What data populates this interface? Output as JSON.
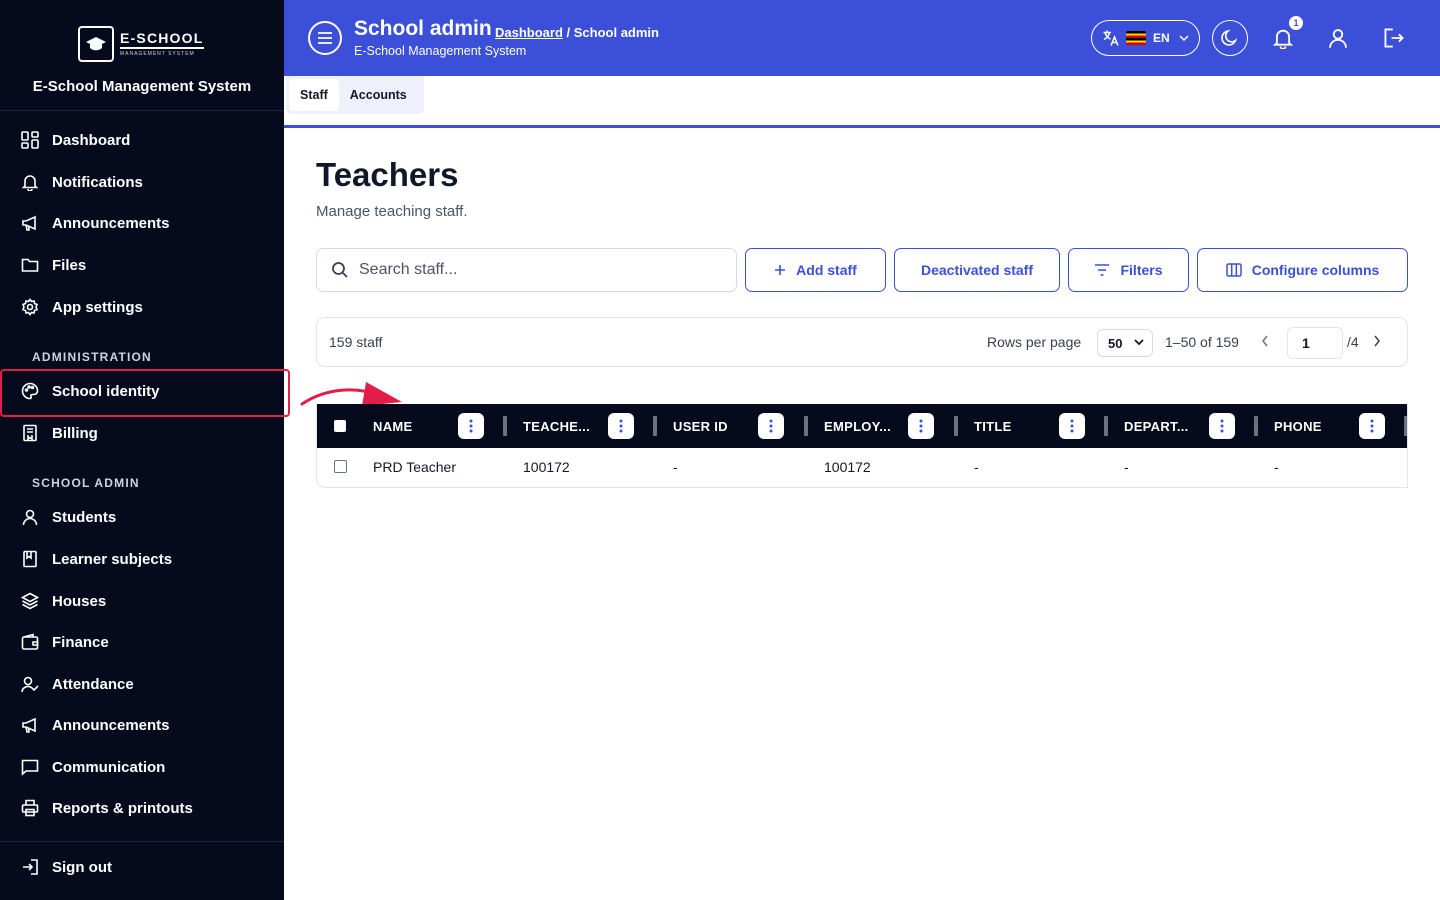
{
  "app": {
    "logo_main": "E-SCHOOL",
    "logo_sub": "MANAGEMENT SYSTEM",
    "name": "E-School Management System"
  },
  "sidebar": {
    "main_items": [
      {
        "label": "Dashboard",
        "icon": "grid-icon"
      },
      {
        "label": "Notifications",
        "icon": "bell-icon"
      },
      {
        "label": "Announcements",
        "icon": "megaphone-icon"
      },
      {
        "label": "Files",
        "icon": "folder-icon"
      },
      {
        "label": "App settings",
        "icon": "gear-icon"
      }
    ],
    "admin_label": "ADMINISTRATION",
    "admin_items": [
      {
        "label": "School identity",
        "icon": "palette-icon"
      },
      {
        "label": "Billing",
        "icon": "receipt-icon"
      }
    ],
    "school_label": "SCHOOL ADMIN",
    "school_items": [
      {
        "label": "Students",
        "icon": "user-icon"
      },
      {
        "label": "Learner subjects",
        "icon": "book-icon"
      },
      {
        "label": "Houses",
        "icon": "layers-icon"
      },
      {
        "label": "Finance",
        "icon": "wallet-icon"
      },
      {
        "label": "Attendance",
        "icon": "user-check-icon"
      },
      {
        "label": "Announcements",
        "icon": "megaphone-icon"
      },
      {
        "label": "Communication",
        "icon": "chat-icon"
      },
      {
        "label": "Reports & printouts",
        "icon": "printer-icon"
      }
    ],
    "signout": "Sign out"
  },
  "header": {
    "title": "School admin",
    "breadcrumb_link": "Dashboard",
    "breadcrumb_rest": " / School admin",
    "subtitle": "E-School Management System",
    "lang_code": "EN",
    "notification_count": "1"
  },
  "tabs": [
    "Staff",
    "Accounts"
  ],
  "page": {
    "title": "Teachers",
    "subtitle": "Manage teaching staff.",
    "search_placeholder": "Search staff...",
    "add_staff": "Add staff",
    "deactivated_staff": "Deactivated staff",
    "filters": "Filters",
    "configure_columns": "Configure columns"
  },
  "pagination": {
    "count": "159 staff",
    "rows_per_page_label": "Rows per page",
    "rows_per_page": "50",
    "range": "1–50 of 159",
    "page": "1",
    "total_pages": "/4"
  },
  "table": {
    "columns": [
      "NAME",
      "TEACHE...",
      "USER ID",
      "EMPLOY...",
      "TITLE",
      "DEPART...",
      "PHONE"
    ],
    "rows": [
      [
        "PRD Teacher",
        "100172",
        "-",
        "100172",
        "-",
        "-",
        "-"
      ]
    ]
  },
  "colors": {
    "primary": "#3b4fd8",
    "sidebar_bg": "#050a1c",
    "highlight": "#e11d48"
  }
}
